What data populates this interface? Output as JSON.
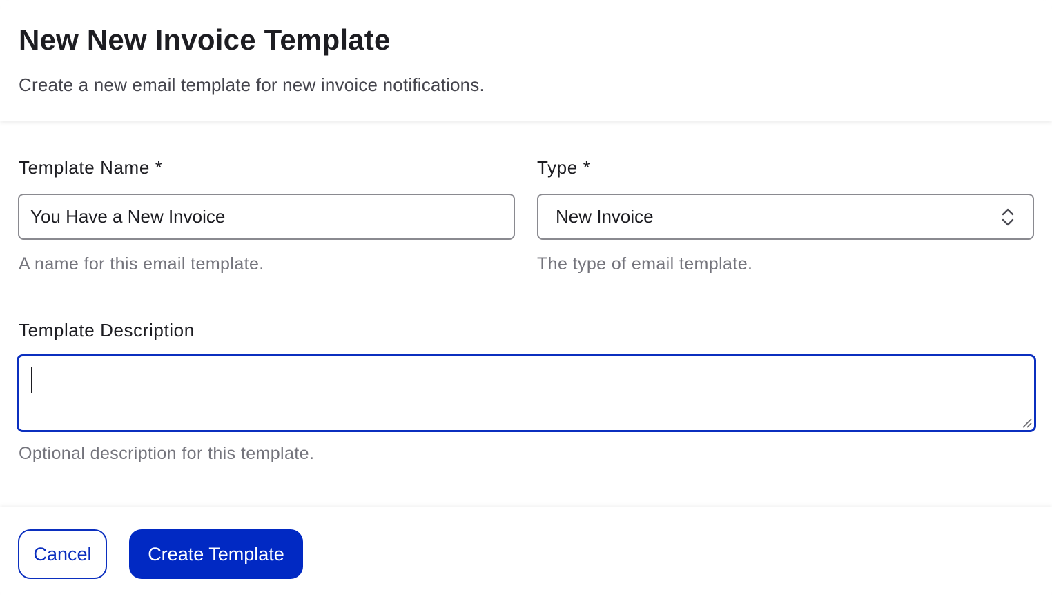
{
  "dialog": {
    "title": "New New Invoice Template",
    "subtitle": "Create a new email template for new invoice notifications."
  },
  "form": {
    "template_name": {
      "label": "Template Name *",
      "value": "You Have a New Invoice",
      "help": "A name for this email template."
    },
    "type": {
      "label": "Type *",
      "selected": "New Invoice",
      "help": "The type of email template."
    },
    "description": {
      "label": "Template Description",
      "value": "",
      "help": "Optional description for this template."
    }
  },
  "footer": {
    "cancel_label": "Cancel",
    "create_label": "Create Template"
  },
  "icons": {
    "select_arrows": "chevron-up-down-icon",
    "resize_handle": "resize-handle-icon"
  },
  "colors": {
    "accent": "#0129c3",
    "focus_border": "#0b2fbf",
    "help_text": "#74747c"
  }
}
